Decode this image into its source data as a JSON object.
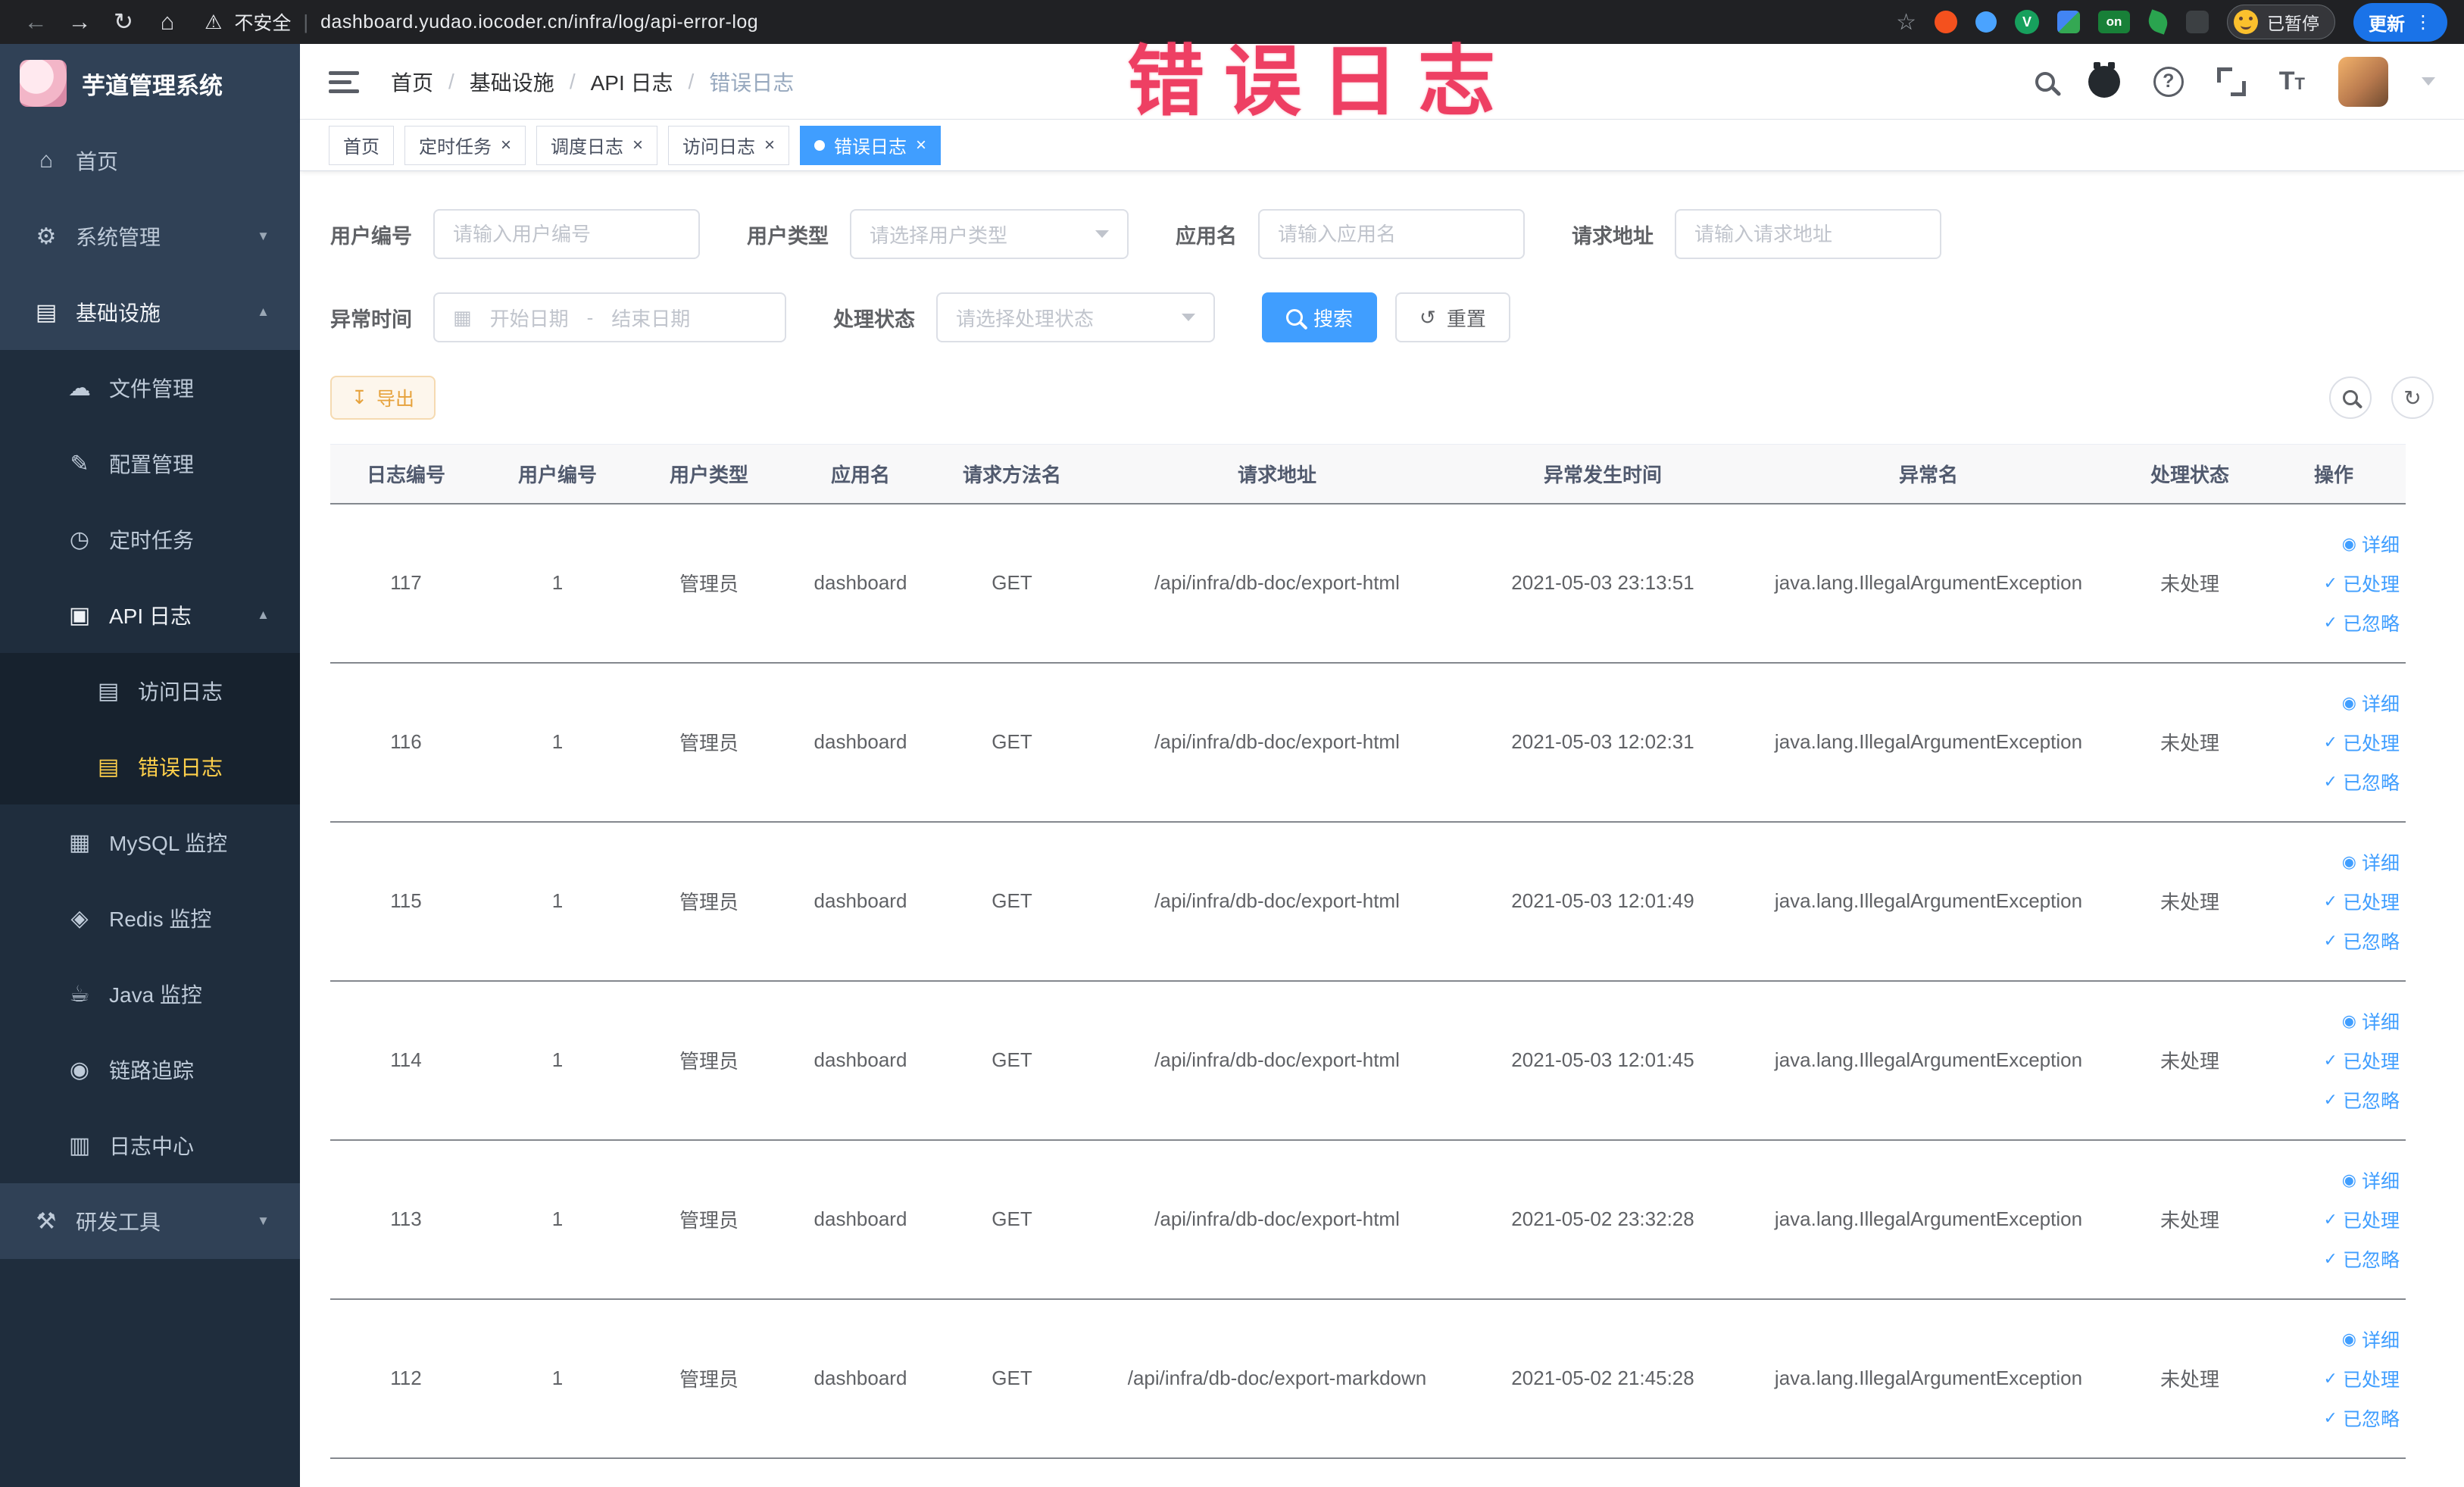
{
  "icons": {
    "close": "×",
    "chevron_down": "▼",
    "chevron_up": "▲",
    "check": "✓",
    "eye": "◉",
    "download": "↧",
    "calendar": "▦",
    "refresh": "↻",
    "reset": "↺",
    "back_arrow": "←",
    "forward_arrow": "→",
    "home": "⌂",
    "star": "☆",
    "warning": "⚠",
    "ellipsis": "⋮",
    "bar": "|"
  },
  "browser": {
    "security_label": "不安全",
    "url": "dashboard.yudao.iocoder.cn/infra/log/api-error-log",
    "extension_v_label": "V",
    "extension_on_label": "on",
    "paused_badge": "已暂停",
    "update_button": "更新"
  },
  "annotation": {
    "text": "错误日志"
  },
  "sidebar": {
    "logo_title": "芋道管理系统",
    "items": [
      {
        "icon": "⌂",
        "label": "首页"
      },
      {
        "icon": "⚙",
        "label": "系统管理"
      },
      {
        "icon": "▤",
        "label": "基础设施"
      },
      {
        "icon": "☁",
        "label": "文件管理"
      },
      {
        "icon": "✎",
        "label": "配置管理"
      },
      {
        "icon": "◷",
        "label": "定时任务"
      },
      {
        "icon": "▣",
        "label": "API 日志"
      },
      {
        "icon": "▤",
        "label": "访问日志"
      },
      {
        "icon": "▤",
        "label": "错误日志"
      },
      {
        "icon": "▦",
        "label": "MySQL 监控"
      },
      {
        "icon": "◈",
        "label": "Redis 监控"
      },
      {
        "icon": "☕",
        "label": "Java 监控"
      },
      {
        "icon": "◉",
        "label": "链路追踪"
      },
      {
        "icon": "▥",
        "label": "日志中心"
      },
      {
        "icon": "⚒",
        "label": "研发工具"
      }
    ]
  },
  "header": {
    "breadcrumb": [
      "首页",
      "基础设施",
      "API 日志",
      "错误日志"
    ]
  },
  "tabs": [
    {
      "label": "首页"
    },
    {
      "label": "定时任务"
    },
    {
      "label": "调度日志"
    },
    {
      "label": "访问日志"
    },
    {
      "label": "错误日志"
    }
  ],
  "filters": {
    "user_id": {
      "label": "用户编号",
      "placeholder": "请输入用户编号"
    },
    "user_type": {
      "label": "用户类型",
      "placeholder": "请选择用户类型"
    },
    "app_name": {
      "label": "应用名",
      "placeholder": "请输入应用名"
    },
    "request_url": {
      "label": "请求地址",
      "placeholder": "请输入请求地址"
    },
    "exception_time": {
      "label": "异常时间",
      "start_placeholder": "开始日期",
      "separator": "-",
      "end_placeholder": "结束日期"
    },
    "process_status": {
      "label": "处理状态",
      "placeholder": "请选择处理状态"
    },
    "search_label": "搜索",
    "reset_label": "重置"
  },
  "toolbar": {
    "export_label": "导出"
  },
  "table": {
    "columns": [
      "日志编号",
      "用户编号",
      "用户类型",
      "应用名",
      "请求方法名",
      "请求地址",
      "异常发生时间",
      "异常名",
      "处理状态",
      "操作"
    ],
    "actions": {
      "detail": "详细",
      "processed": "已处理",
      "ignored": "已忽略"
    },
    "rows": [
      {
        "id": "117",
        "user_id": "1",
        "user_type": "管理员",
        "app": "dashboard",
        "method": "GET",
        "url": "/api/infra/db-doc/export-html",
        "time": "2021-05-03 23:13:51",
        "exception": "java.lang.IllegalArgumentException",
        "status": "未处理"
      },
      {
        "id": "116",
        "user_id": "1",
        "user_type": "管理员",
        "app": "dashboard",
        "method": "GET",
        "url": "/api/infra/db-doc/export-html",
        "time": "2021-05-03 12:02:31",
        "exception": "java.lang.IllegalArgumentException",
        "status": "未处理"
      },
      {
        "id": "115",
        "user_id": "1",
        "user_type": "管理员",
        "app": "dashboard",
        "method": "GET",
        "url": "/api/infra/db-doc/export-html",
        "time": "2021-05-03 12:01:49",
        "exception": "java.lang.IllegalArgumentException",
        "status": "未处理"
      },
      {
        "id": "114",
        "user_id": "1",
        "user_type": "管理员",
        "app": "dashboard",
        "method": "GET",
        "url": "/api/infra/db-doc/export-html",
        "time": "2021-05-03 12:01:45",
        "exception": "java.lang.IllegalArgumentException",
        "status": "未处理"
      },
      {
        "id": "113",
        "user_id": "1",
        "user_type": "管理员",
        "app": "dashboard",
        "method": "GET",
        "url": "/api/infra/db-doc/export-html",
        "time": "2021-05-02 23:32:28",
        "exception": "java.lang.IllegalArgumentException",
        "status": "未处理"
      },
      {
        "id": "112",
        "user_id": "1",
        "user_type": "管理员",
        "app": "dashboard",
        "method": "GET",
        "url": "/api/infra/db-doc/export-markdown",
        "time": "2021-05-02 21:45:28",
        "exception": "java.lang.IllegalArgumentException",
        "status": "未处理"
      }
    ]
  }
}
